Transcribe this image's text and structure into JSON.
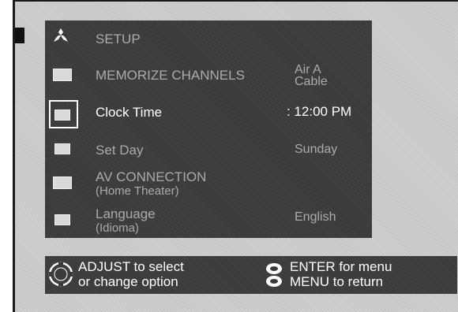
{
  "menu": {
    "title": "SETUP",
    "rows": [
      {
        "label": "MEMORIZE CHANNELS",
        "value_line1": "Air A",
        "value_line2": "Cable"
      },
      {
        "label": "Clock Time",
        "value": ": 12:00 PM"
      },
      {
        "label": "Set Day",
        "value": "Sunday"
      },
      {
        "label": "AV CONNECTION",
        "sublabel": "(Home Theater)"
      },
      {
        "label": "Language",
        "sublabel": "(Idioma)",
        "value": "English"
      }
    ]
  },
  "help": {
    "adjust_line1": "ADJUST  to select",
    "adjust_line2": "or change option",
    "enter_line1": "ENTER for menu",
    "enter_line2": "MENU to return"
  },
  "colors": {
    "panel": "#3a3a3a",
    "screen": "#cfcfcf",
    "active_text": "#ffffff",
    "dim_text": "#ababab"
  },
  "icons": [
    "mitsubishi-logo-icon",
    "channel-icon",
    "clock-icon",
    "calendar-icon",
    "av-connection-icon",
    "language-icon",
    "dpad-icon",
    "enter-button-icon"
  ]
}
